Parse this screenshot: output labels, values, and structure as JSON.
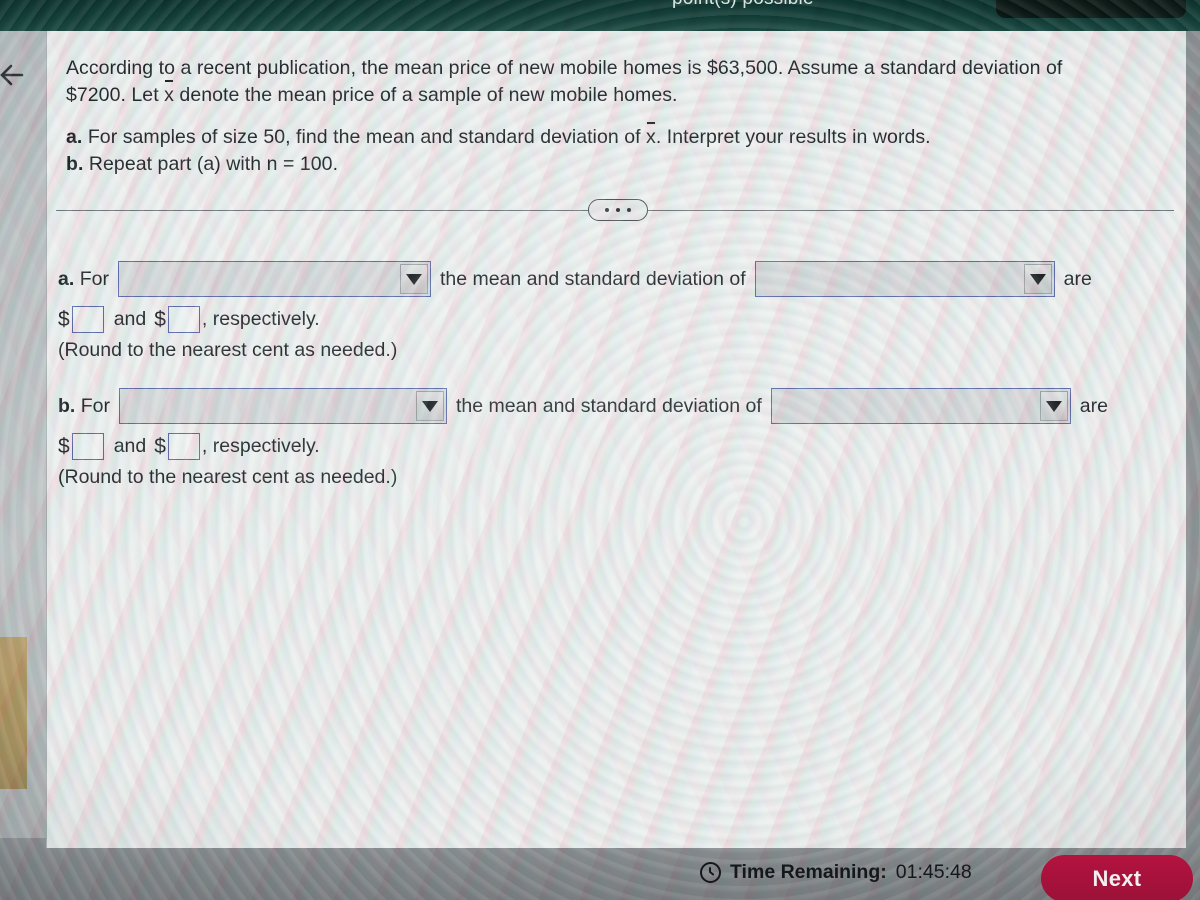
{
  "header": {
    "points_possible": "point(s) possible",
    "pill_name": "header-menu-pill"
  },
  "nav": {
    "back_arrow": "back-arrow-icon"
  },
  "question": {
    "line1": "According to a recent publication, the mean price of new mobile homes is $63,500. Assume a standard deviation of",
    "line2_pre": "$7200. Let ",
    "line2_var": "x",
    "line2_post": " denote the mean price of a sample of new mobile homes.",
    "part_a_label": "a.",
    "part_a_pre": " For samples of size 50, find the mean and standard deviation of ",
    "part_a_var": "x",
    "part_a_post": ". Interpret your results in words.",
    "part_b_label": "b.",
    "part_b_text": " Repeat part (a) with n = 100."
  },
  "divider": {
    "ellipsis_label": "more-options"
  },
  "answers": {
    "a": {
      "label": "a.",
      "for_word": "For",
      "select1_value": "",
      "middle_text": "the mean and standard deviation of",
      "select2_value": "",
      "are_word": "are",
      "dollar_sign": "$",
      "and_word": "and",
      "respectively_text": ", respectively.",
      "blank1_value": "",
      "blank2_value": "",
      "round_note": "(Round to the nearest cent as needed.)"
    },
    "b": {
      "label": "b.",
      "for_word": "For",
      "select1_value": "",
      "middle_text": "the mean and standard deviation of",
      "select2_value": "",
      "are_word": "are",
      "dollar_sign": "$",
      "and_word": "and",
      "respectively_text": ", respectively.",
      "blank1_value": "",
      "blank2_value": "",
      "round_note": "(Round to the nearest cent as needed.)"
    }
  },
  "footer": {
    "clock_icon": "clock-icon",
    "time_label": "Time Remaining:",
    "time_value": "01:45:48",
    "next_label": "Next"
  },
  "colors": {
    "header_green": "#0d3a33",
    "next_button_crimson": "#a8123c",
    "field_border_blue": "#5566a6",
    "page_bg": "#eef0ef"
  }
}
